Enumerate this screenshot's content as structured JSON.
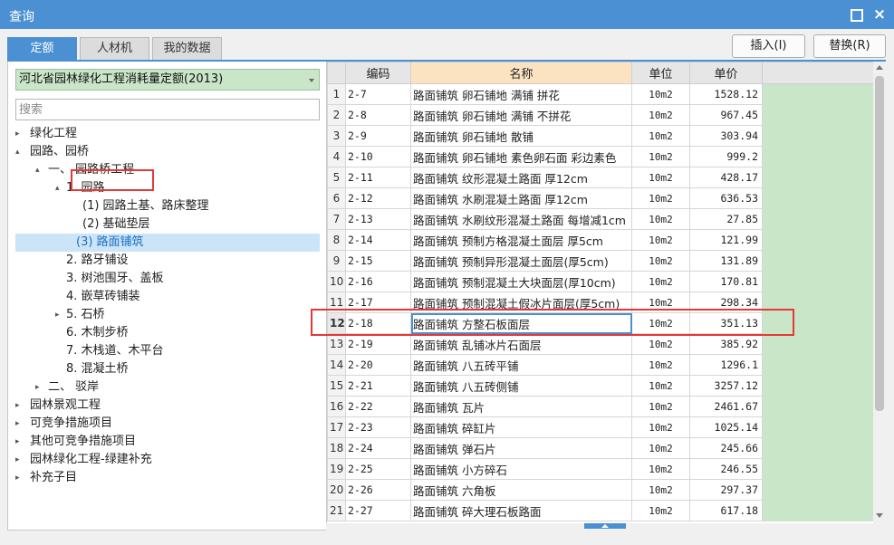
{
  "window": {
    "title": "查询",
    "maximize_icon": "maximize-icon",
    "close_glyph": "×"
  },
  "tabs": [
    {
      "label": "定额",
      "active": true
    },
    {
      "label": "人材机",
      "active": false
    },
    {
      "label": "我的数据",
      "active": false
    }
  ],
  "buttons": {
    "insert_label": "插入(I)",
    "replace_label": "替换(R)"
  },
  "library": {
    "selected": "河北省园林绿化工程消耗量定额(2013)"
  },
  "search": {
    "placeholder": "搜索",
    "value": ""
  },
  "tree": {
    "nodes": [
      {
        "label": "绿化工程",
        "caret": "▸"
      },
      {
        "label": "园路、园桥",
        "caret": "▴"
      },
      {
        "label": "一、 园路桥工程",
        "caret": "▴"
      },
      {
        "label": "1. 园路",
        "caret": "▴"
      },
      {
        "label": "(1) 园路土基、路床整理",
        "caret": ""
      },
      {
        "label": "(2) 基础垫层",
        "caret": ""
      },
      {
        "label": "(3) 路面铺筑",
        "caret": "",
        "selected": true
      },
      {
        "label": "2. 路牙铺设",
        "caret": ""
      },
      {
        "label": "3. 树池围牙、盖板",
        "caret": ""
      },
      {
        "label": "4. 嵌草砖铺装",
        "caret": ""
      },
      {
        "label": "5. 石桥",
        "caret": "▸"
      },
      {
        "label": "6. 木制步桥",
        "caret": ""
      },
      {
        "label": "7. 木栈道、木平台",
        "caret": ""
      },
      {
        "label": "8. 混凝土桥",
        "caret": ""
      },
      {
        "label": "二、 驳岸",
        "caret": "▸"
      },
      {
        "label": "园林景观工程",
        "caret": "▸"
      },
      {
        "label": "可竞争措施项目",
        "caret": "▸"
      },
      {
        "label": "其他可竞争措施项目",
        "caret": "▸"
      },
      {
        "label": "园林绿化工程-绿建补充",
        "caret": "▸"
      },
      {
        "label": "补充子目",
        "caret": "▸"
      }
    ]
  },
  "table": {
    "headers": {
      "code": "编码",
      "name": "名称",
      "unit": "单位",
      "price": "单价"
    },
    "selected_row": 12,
    "rows": [
      {
        "n": "1",
        "code": "2-7",
        "name": "路面铺筑 卵石铺地 满铺 拼花",
        "unit": "10m2",
        "price": "1528.12"
      },
      {
        "n": "2",
        "code": "2-8",
        "name": "路面铺筑 卵石铺地 满铺 不拼花",
        "unit": "10m2",
        "price": "967.45"
      },
      {
        "n": "3",
        "code": "2-9",
        "name": "路面铺筑 卵石铺地 散铺",
        "unit": "10m2",
        "price": "303.94"
      },
      {
        "n": "4",
        "code": "2-10",
        "name": "路面铺筑 卵石铺地 素色卵石面 彩边素色",
        "unit": "10m2",
        "price": "999.2"
      },
      {
        "n": "5",
        "code": "2-11",
        "name": "路面铺筑 纹形混凝土路面 厚12cm",
        "unit": "10m2",
        "price": "428.17"
      },
      {
        "n": "6",
        "code": "2-12",
        "name": "路面铺筑 水刷混凝土路面 厚12cm",
        "unit": "10m2",
        "price": "636.53"
      },
      {
        "n": "7",
        "code": "2-13",
        "name": "路面铺筑 水刷纹形混凝土路面 每增减1cm",
        "unit": "10m2",
        "price": "27.85"
      },
      {
        "n": "8",
        "code": "2-14",
        "name": "路面铺筑 预制方格混凝土面层 厚5cm",
        "unit": "10m2",
        "price": "121.99"
      },
      {
        "n": "9",
        "code": "2-15",
        "name": "路面铺筑 预制异形混凝土面层(厚5cm)",
        "unit": "10m2",
        "price": "131.89"
      },
      {
        "n": "10",
        "code": "2-16",
        "name": "路面铺筑 预制混凝土大块面层(厚10cm)",
        "unit": "10m2",
        "price": "170.81"
      },
      {
        "n": "11",
        "code": "2-17",
        "name": "路面铺筑 预制混凝土假冰片面层(厚5cm)",
        "unit": "10m2",
        "price": "298.34"
      },
      {
        "n": "12",
        "code": "2-18",
        "name": "路面铺筑 方整石板面层",
        "unit": "10m2",
        "price": "351.13"
      },
      {
        "n": "13",
        "code": "2-19",
        "name": "路面铺筑 乱铺冰片石面层",
        "unit": "10m2",
        "price": "385.92"
      },
      {
        "n": "14",
        "code": "2-20",
        "name": "路面铺筑 八五砖平铺",
        "unit": "10m2",
        "price": "1296.1"
      },
      {
        "n": "15",
        "code": "2-21",
        "name": "路面铺筑 八五砖侧铺",
        "unit": "10m2",
        "price": "3257.12"
      },
      {
        "n": "16",
        "code": "2-22",
        "name": "路面铺筑 瓦片",
        "unit": "10m2",
        "price": "2461.67"
      },
      {
        "n": "17",
        "code": "2-23",
        "name": "路面铺筑 碎缸片",
        "unit": "10m2",
        "price": "1025.14"
      },
      {
        "n": "18",
        "code": "2-24",
        "name": "路面铺筑 弹石片",
        "unit": "10m2",
        "price": "245.66"
      },
      {
        "n": "19",
        "code": "2-25",
        "name": "路面铺筑 小方碎石",
        "unit": "10m2",
        "price": "246.55"
      },
      {
        "n": "20",
        "code": "2-26",
        "name": "路面铺筑 六角板",
        "unit": "10m2",
        "price": "297.37"
      },
      {
        "n": "21",
        "code": "2-27",
        "name": "路面铺筑 碎大理石板路面",
        "unit": "10m2",
        "price": "617.18"
      }
    ]
  },
  "colors": {
    "accent": "#4a90d2",
    "highlight": "#e53935",
    "green_fill": "#c9e6c9",
    "header_orange": "#fbe3c2",
    "selected_tree": "#cce4f7"
  }
}
